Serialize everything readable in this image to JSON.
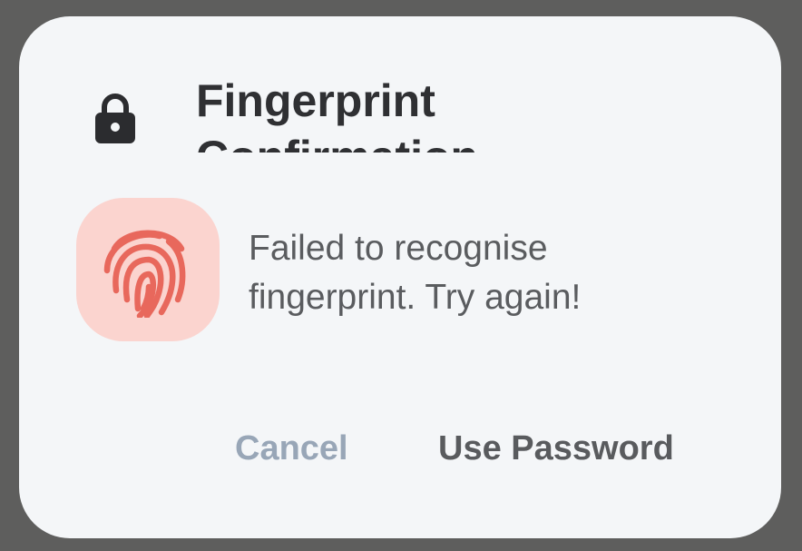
{
  "dialog": {
    "title": "Fingerprint Confirmation",
    "message": "Failed to recognise fingerprint. Try again!",
    "icons": {
      "header": "lock-icon",
      "status": "fingerprint-icon"
    },
    "colors": {
      "backdrop": "#5e5e5d",
      "surface": "#f4f6f8",
      "title": "#2f3033",
      "message": "#5a5c5f",
      "fingerprint_tile": "#fbd4cf",
      "fingerprint_stroke": "#e8685c",
      "cancel_text": "#98a6b7",
      "password_text": "#595b5e"
    },
    "buttons": {
      "cancel": "Cancel",
      "use_password": "Use Password"
    }
  }
}
